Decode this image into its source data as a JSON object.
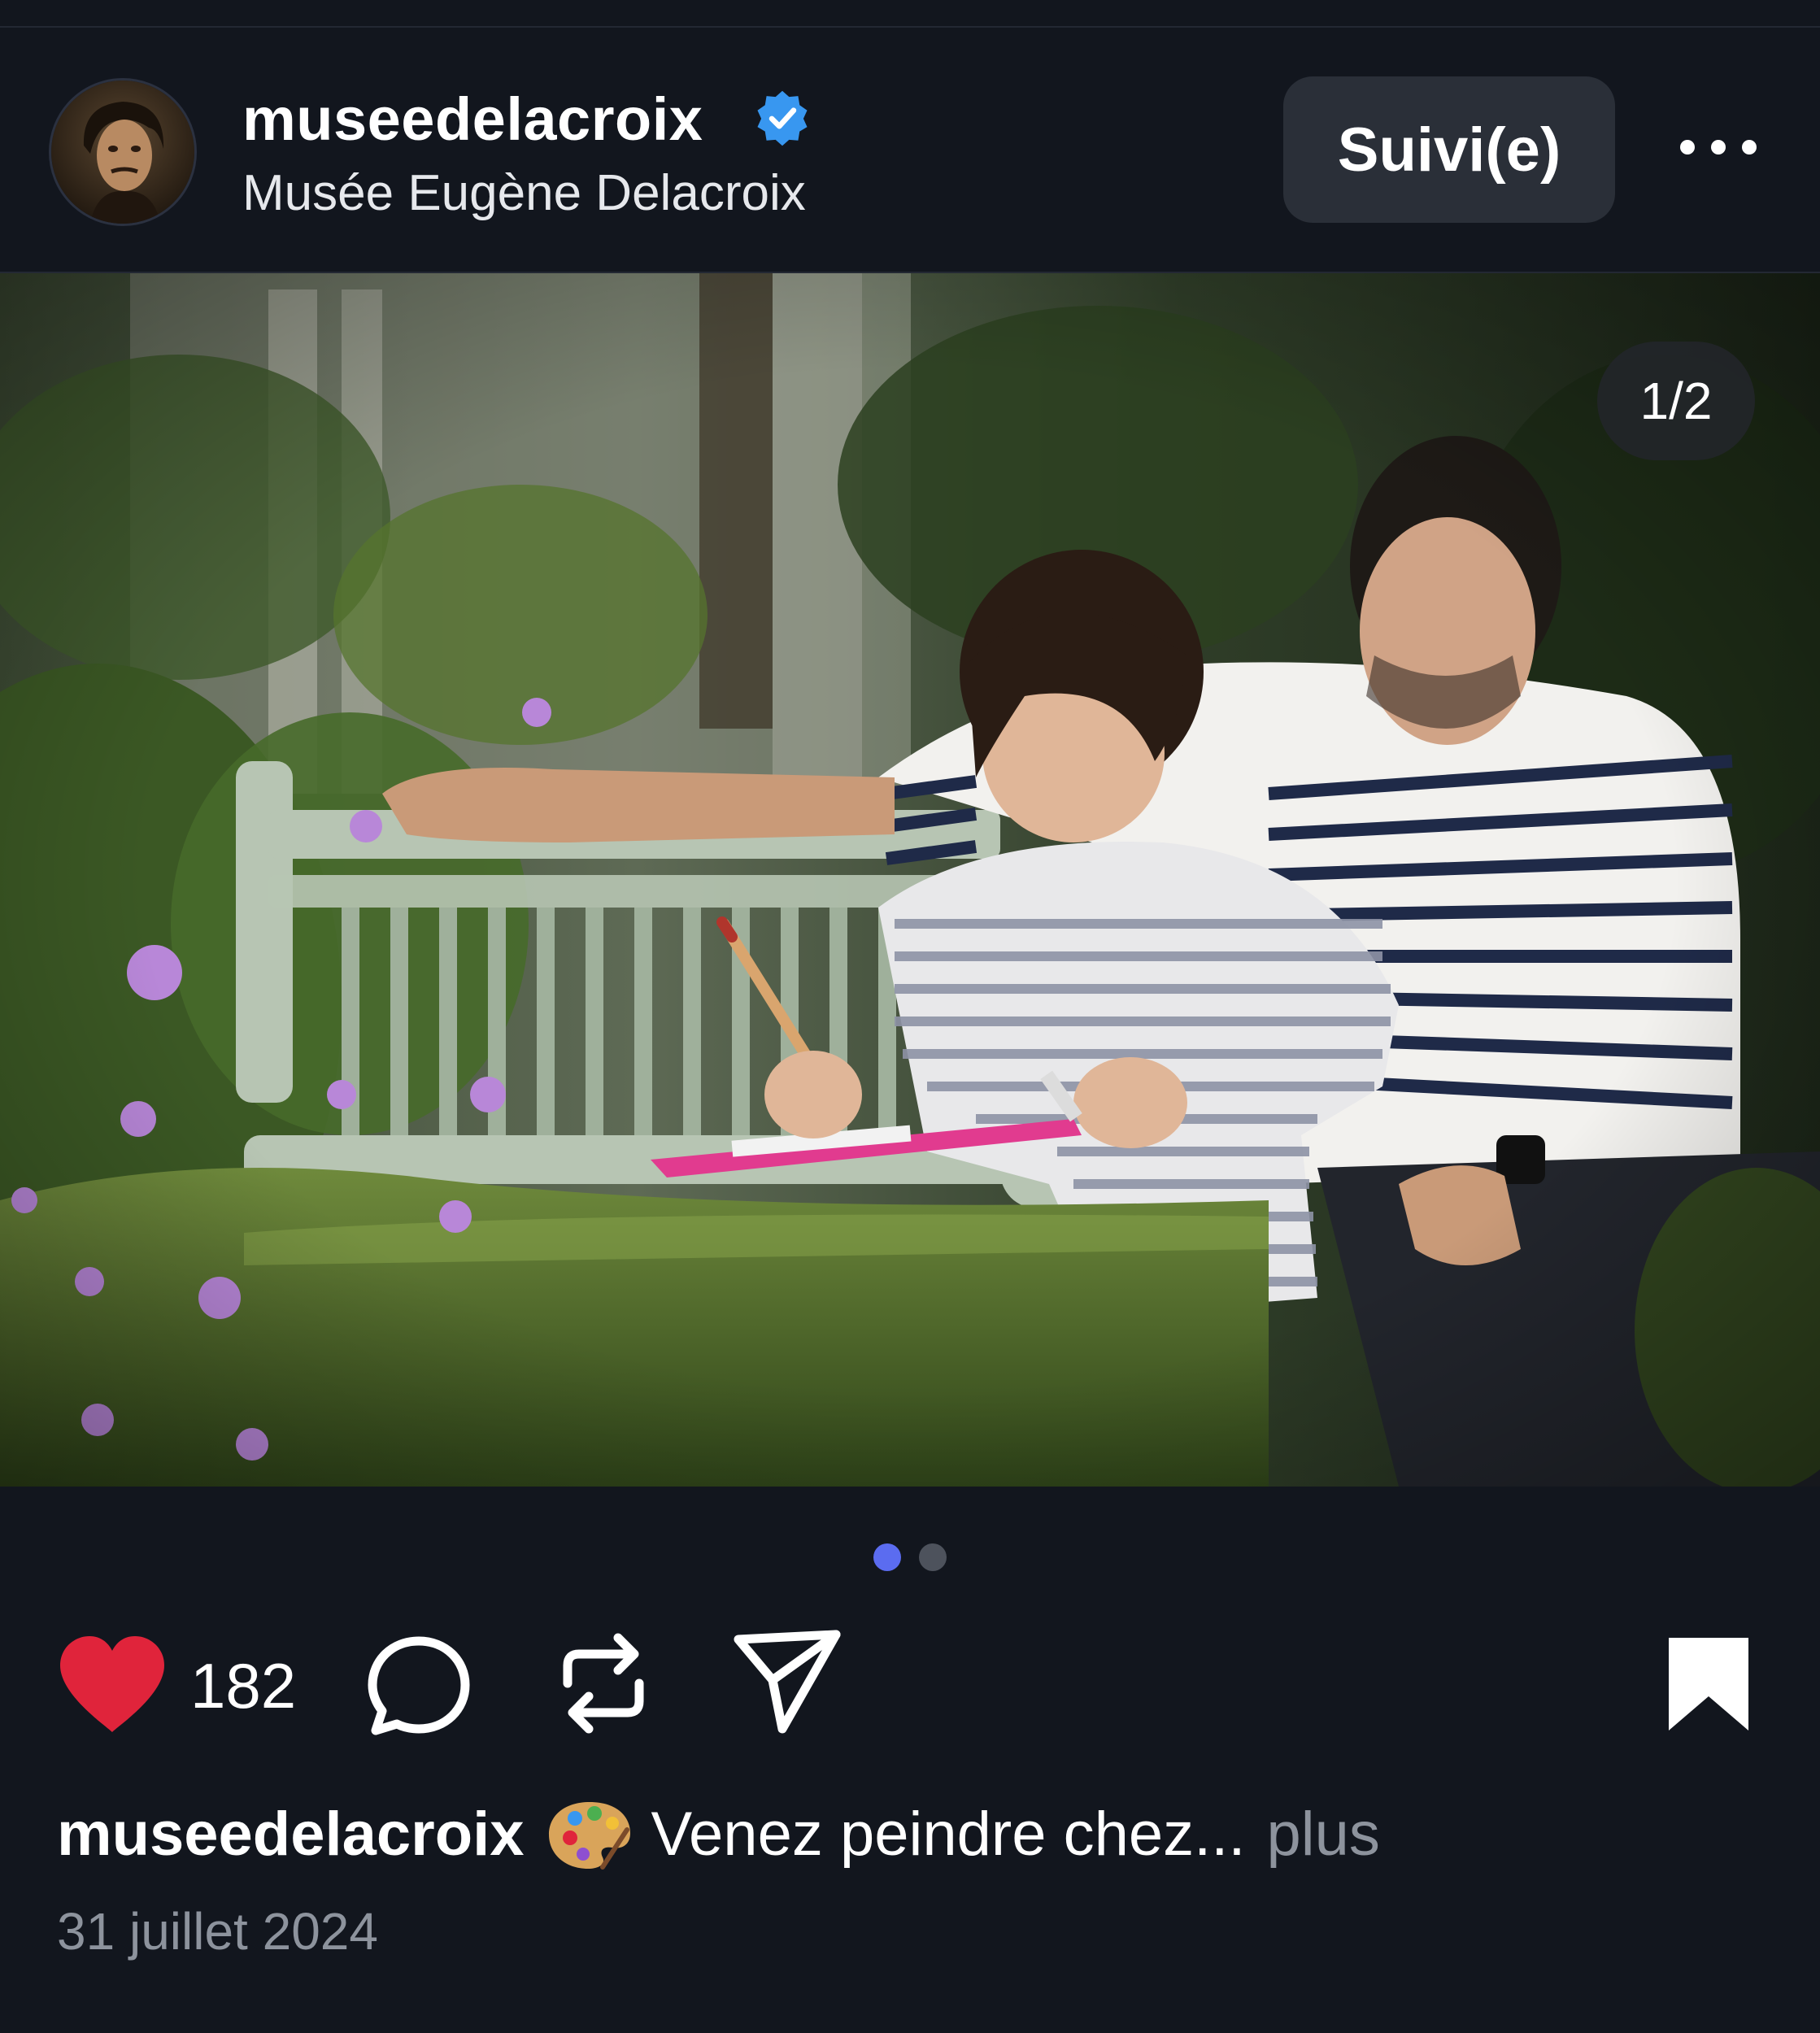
{
  "post": {
    "username": "museedelacroix",
    "full_name": "Musée Eugène Delacroix",
    "follow_label": "Suivi(e)",
    "image_counter": "1/2",
    "likes": "182",
    "caption_username": "museedelacroix",
    "caption_emoji": "🎨",
    "caption_text": "Venez peindre chez...",
    "caption_more": "plus",
    "date": "31 juillet 2024"
  },
  "carousel": {
    "current": 1,
    "total": 2
  },
  "icons": {
    "verified": "verified-badge-icon",
    "more": "more-options-icon",
    "like": "heart-icon",
    "comment": "comment-bubble-icon",
    "repost": "repost-icon",
    "share": "send-icon",
    "save": "bookmark-icon",
    "palette": "artist-palette-icon"
  },
  "colors": {
    "background": "#12161e",
    "button": "#2a2f38",
    "like": "#e0243b",
    "verified": "#3897f0",
    "muted_text": "#8d939d",
    "dot_active": "#5b6cf0",
    "dot_inactive": "#4d525c"
  }
}
